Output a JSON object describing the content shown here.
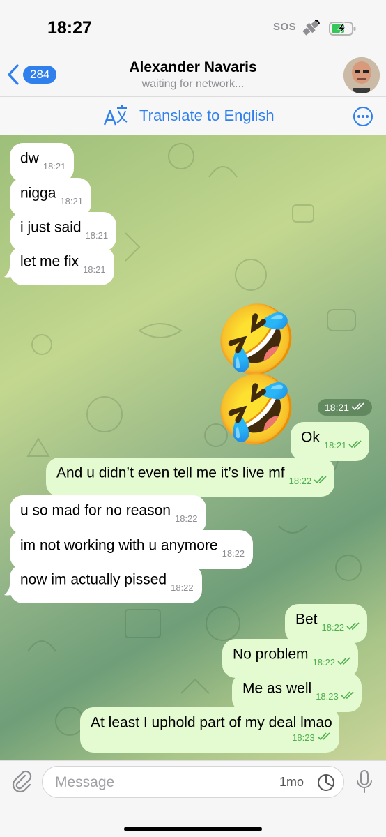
{
  "status_bar": {
    "time": "18:27",
    "sos": "SOS"
  },
  "nav": {
    "back_count": "284",
    "name": "Alexander Navaris",
    "status": "waiting for network..."
  },
  "translate": {
    "label": "Translate to English"
  },
  "messages": [
    {
      "dir": "in",
      "text": "dw",
      "time": "18:21"
    },
    {
      "dir": "in",
      "text": "nigga",
      "time": "18:21"
    },
    {
      "dir": "in",
      "text": "i just said",
      "time": "18:21"
    },
    {
      "dir": "in",
      "text": "let me fix",
      "time": "18:21"
    },
    {
      "dir": "out",
      "emoji": "🤣 🤣",
      "time": "18:21"
    },
    {
      "dir": "out",
      "text": "Ok",
      "time": "18:21"
    },
    {
      "dir": "out",
      "text": "And u didn’t even tell me it’s live mf",
      "time": "18:22"
    },
    {
      "dir": "in",
      "text": "u so mad for no reason",
      "time": "18:22"
    },
    {
      "dir": "in",
      "text": "im not working with u anymore",
      "time": "18:22"
    },
    {
      "dir": "in",
      "text": "now im actually pissed",
      "time": "18:22"
    },
    {
      "dir": "out",
      "text": "Bet",
      "time": "18:22"
    },
    {
      "dir": "out",
      "text": "No problem",
      "time": "18:22"
    },
    {
      "dir": "out",
      "text": "Me as well",
      "time": "18:23"
    },
    {
      "dir": "out",
      "text": "At least I uphold part of my deal lmao",
      "time": "18:23"
    }
  ],
  "input": {
    "placeholder": "Message",
    "timer_label": "1mo"
  },
  "colors": {
    "accent": "#2f80ed",
    "outgoing_bubble": "#e4fbd2",
    "incoming_bubble": "#ffffff",
    "read_ticks": "#4fae4e"
  },
  "icons": [
    "satellite-icon",
    "battery-charging-icon",
    "back-chevron-icon",
    "translate-icon",
    "more-icon",
    "attach-icon",
    "timer-icon",
    "microphone-icon"
  ]
}
